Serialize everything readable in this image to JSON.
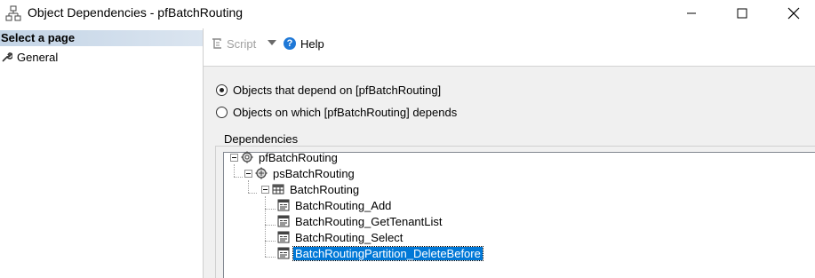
{
  "window": {
    "title": "Object Dependencies - pfBatchRouting",
    "icons": [
      "dependencies-icon",
      "minimize-icon",
      "maximize-icon",
      "close-icon"
    ]
  },
  "sidebar": {
    "header": "Select a page",
    "items": [
      {
        "label": "General",
        "icon": "wrench-icon"
      }
    ]
  },
  "toolbar": {
    "script_label": "Script",
    "help_label": "Help"
  },
  "options": {
    "depend_on_label": "Objects that depend on [pfBatchRouting]",
    "depends_label": "Objects on which [pfBatchRouting] depends",
    "selected": "depend_on"
  },
  "dependencies": {
    "group_label": "Dependencies",
    "nodes": [
      {
        "label": "pfBatchRouting",
        "icon": "partition-function-icon",
        "level": 0,
        "expanded": true
      },
      {
        "label": "psBatchRouting",
        "icon": "partition-scheme-icon",
        "level": 1,
        "expanded": true
      },
      {
        "label": "BatchRouting",
        "icon": "table-icon",
        "level": 2,
        "expanded": true
      },
      {
        "label": "BatchRouting_Add",
        "icon": "stored-procedure-icon",
        "level": 3
      },
      {
        "label": "BatchRouting_GetTenantList",
        "icon": "stored-procedure-icon",
        "level": 3
      },
      {
        "label": "BatchRouting_Select",
        "icon": "stored-procedure-icon",
        "level": 3
      },
      {
        "label": "BatchRoutingPartition_DeleteBefore",
        "icon": "stored-procedure-icon",
        "level": 3,
        "selected": true
      }
    ]
  },
  "colors": {
    "selection": "#0078d7",
    "page_header_gradient_start": "#c3d4e6",
    "help_icon": "#1e78d7"
  }
}
